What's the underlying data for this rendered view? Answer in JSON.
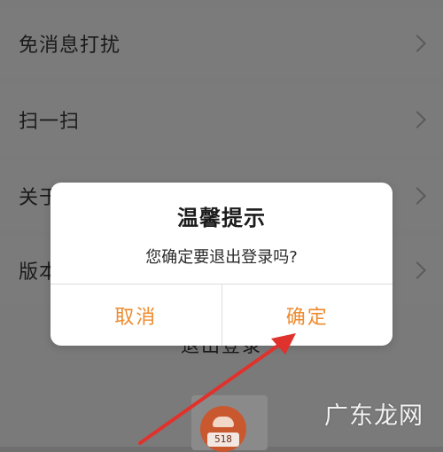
{
  "settings": {
    "items": [
      {
        "label": "免消息打扰"
      },
      {
        "label": "扫一扫"
      },
      {
        "label": "关于"
      },
      {
        "label": "版本"
      }
    ],
    "logout_label": "退出登录"
  },
  "dialog": {
    "title": "温馨提示",
    "message": "您确定要退出登录吗?",
    "cancel_label": "取消",
    "confirm_label": "确定"
  },
  "bottom_logo": {
    "badge": "518"
  },
  "watermark": "广东龙网",
  "colors": {
    "accent": "#ee8b2e",
    "annotation": "#e0322c"
  }
}
